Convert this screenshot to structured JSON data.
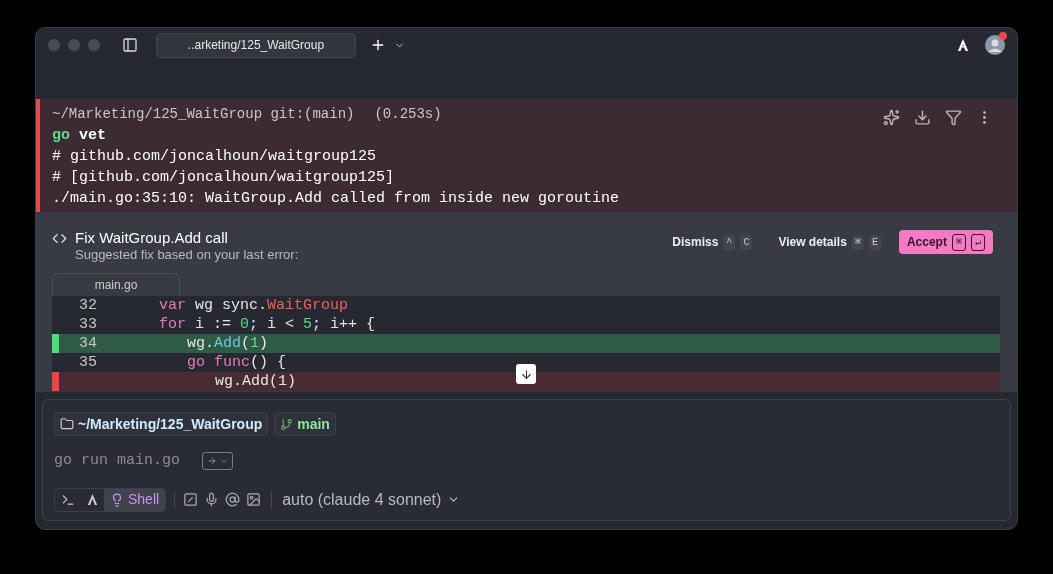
{
  "tab": {
    "title": "..arketing/125_WaitGroup"
  },
  "avatar": {
    "notification": true
  },
  "block": {
    "failed": true,
    "path": "~/Marketing/125_WaitGroup git:(main)",
    "duration": "(0.253s)",
    "command_keyword": "go",
    "command_rest": "vet",
    "output": [
      "# github.com/joncalhoun/waitgroup125",
      "# [github.com/joncalhoun/waitgroup125]",
      "./main.go:35:10: WaitGroup.Add called from inside new goroutine"
    ]
  },
  "suggestion": {
    "title": "Fix WaitGroup.Add call",
    "subtitle": "Suggested fix based on your last error:",
    "actions": [
      {
        "kind": "plain",
        "label": "Dismiss",
        "keys": [
          "^",
          "C"
        ]
      },
      {
        "kind": "plain",
        "label": "View details",
        "keys": [
          "⌘",
          "E"
        ]
      },
      {
        "kind": "primary",
        "label": "Accept",
        "keys": [
          "⌘",
          "↵"
        ]
      }
    ],
    "file": "main.go",
    "lines": [
      {
        "number": "32",
        "added": false,
        "removed": false,
        "tokens": [
          {
            "text": "var",
            "kind": "keyword"
          },
          {
            "text": " wg sync.",
            "kind": "text"
          },
          {
            "text": "WaitGroup",
            "kind": "type"
          }
        ]
      },
      {
        "number": "33",
        "added": false,
        "removed": false,
        "tokens": [
          {
            "text": "for",
            "kind": "keyword"
          },
          {
            "text": " i := ",
            "kind": "text"
          },
          {
            "text": "0",
            "kind": "number"
          },
          {
            "text": "; i < ",
            "kind": "text"
          },
          {
            "text": "5",
            "kind": "number"
          },
          {
            "text": "; i++ {",
            "kind": "text"
          }
        ],
        "children": [
          {
            "number": "34",
            "added": true,
            "removed": false,
            "tokens": [
              {
                "text": "wg.",
                "kind": "text"
              },
              {
                "text": "Add",
                "kind": "function"
              },
              {
                "text": "(",
                "kind": "text"
              },
              {
                "text": "1",
                "kind": "number"
              },
              {
                "text": ")",
                "kind": "text"
              }
            ]
          },
          {
            "number": "35",
            "added": false,
            "removed": false,
            "tokens": [
              {
                "text": "go",
                "kind": "keyword"
              },
              {
                "text": " func",
                "kind": "keyword"
              },
              {
                "text": "() {",
                "kind": "text"
              }
            ],
            "children": [
              {
                "added": false,
                "removed": true,
                "tokens": [
                  {
                    "text": "wg.Add(1)",
                    "kind": "text"
                  }
                ]
              }
            ]
          }
        ]
      }
    ]
  },
  "input": {
    "directory": "~/Marketing/125_WaitGroup",
    "branch": "main",
    "value": "go run main.go",
    "modes": [
      {
        "kind": "terminal",
        "selected": false
      },
      {
        "kind": "agent",
        "selected": false
      },
      {
        "kind": "shell",
        "label": "Shell",
        "selected": true
      }
    ],
    "model": "auto (claude 4 sonnet)"
  }
}
